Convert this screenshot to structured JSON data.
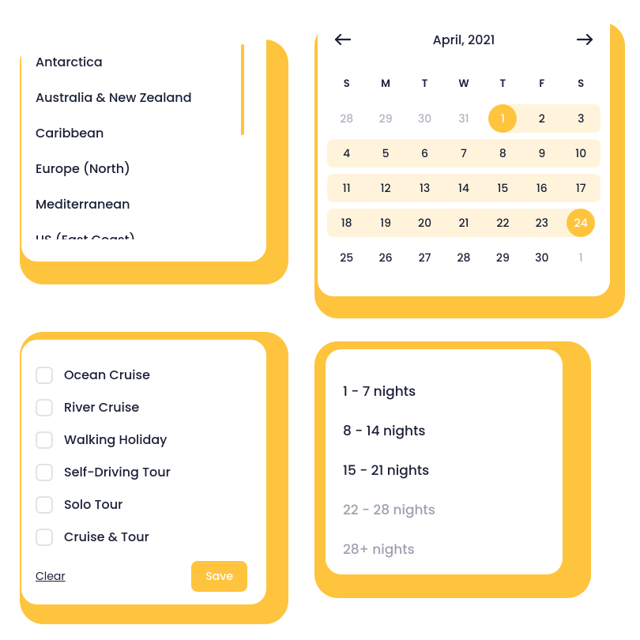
{
  "destinations": {
    "items": [
      "Antarctica",
      "Australia & New Zealand",
      "Caribbean",
      "Europe (North)",
      "Mediterranean",
      "US (East Coast)"
    ]
  },
  "calendar": {
    "title": "April, 2021",
    "dow": [
      "S",
      "M",
      "T",
      "W",
      "T",
      "F",
      "S"
    ],
    "weeks": [
      [
        {
          "d": 28,
          "cur": false
        },
        {
          "d": 29,
          "cur": false
        },
        {
          "d": 30,
          "cur": false
        },
        {
          "d": 31,
          "cur": false
        },
        {
          "d": 1,
          "cur": true,
          "sel": true,
          "range": true,
          "rs": true
        },
        {
          "d": 2,
          "cur": true,
          "range": true
        },
        {
          "d": 3,
          "cur": true,
          "range": true,
          "re": true
        }
      ],
      [
        {
          "d": 4,
          "cur": true,
          "range": true,
          "rs": true
        },
        {
          "d": 5,
          "cur": true,
          "range": true
        },
        {
          "d": 6,
          "cur": true,
          "range": true
        },
        {
          "d": 7,
          "cur": true,
          "range": true
        },
        {
          "d": 8,
          "cur": true,
          "range": true
        },
        {
          "d": 9,
          "cur": true,
          "range": true
        },
        {
          "d": 10,
          "cur": true,
          "range": true,
          "re": true
        }
      ],
      [
        {
          "d": 11,
          "cur": true,
          "range": true,
          "rs": true
        },
        {
          "d": 12,
          "cur": true,
          "range": true
        },
        {
          "d": 13,
          "cur": true,
          "range": true
        },
        {
          "d": 14,
          "cur": true,
          "range": true
        },
        {
          "d": 15,
          "cur": true,
          "range": true
        },
        {
          "d": 16,
          "cur": true,
          "range": true
        },
        {
          "d": 17,
          "cur": true,
          "range": true,
          "re": true
        }
      ],
      [
        {
          "d": 18,
          "cur": true,
          "range": true,
          "rs": true
        },
        {
          "d": 19,
          "cur": true,
          "range": true
        },
        {
          "d": 20,
          "cur": true,
          "range": true
        },
        {
          "d": 21,
          "cur": true,
          "range": true
        },
        {
          "d": 22,
          "cur": true,
          "range": true
        },
        {
          "d": 23,
          "cur": true,
          "range": true
        },
        {
          "d": 24,
          "cur": true,
          "sel": true,
          "range": true,
          "re": true
        }
      ],
      [
        {
          "d": 25,
          "cur": true
        },
        {
          "d": 26,
          "cur": true
        },
        {
          "d": 27,
          "cur": true
        },
        {
          "d": 28,
          "cur": true
        },
        {
          "d": 29,
          "cur": true
        },
        {
          "d": 30,
          "cur": true
        },
        {
          "d": 1,
          "cur": false
        }
      ]
    ]
  },
  "tripTypes": {
    "items": [
      "Ocean Cruise",
      "River Cruise",
      "Walking Holiday",
      "Self-Driving Tour",
      "Solo Tour",
      "Cruise & Tour"
    ],
    "clear_label": "Clear",
    "save_label": "Save"
  },
  "nights": {
    "items": [
      {
        "label": "1 - 7 nights",
        "active": true
      },
      {
        "label": "8 - 14 nights",
        "active": true
      },
      {
        "label": "15 - 21 nights",
        "active": true
      },
      {
        "label": "22 - 28 nights",
        "active": false
      },
      {
        "label": "28+ nights",
        "active": false
      }
    ]
  },
  "colors": {
    "accent": "#FFC43D",
    "text": "#1B2037",
    "muted": "#9EA1B0",
    "range": "#FFF4DB"
  }
}
